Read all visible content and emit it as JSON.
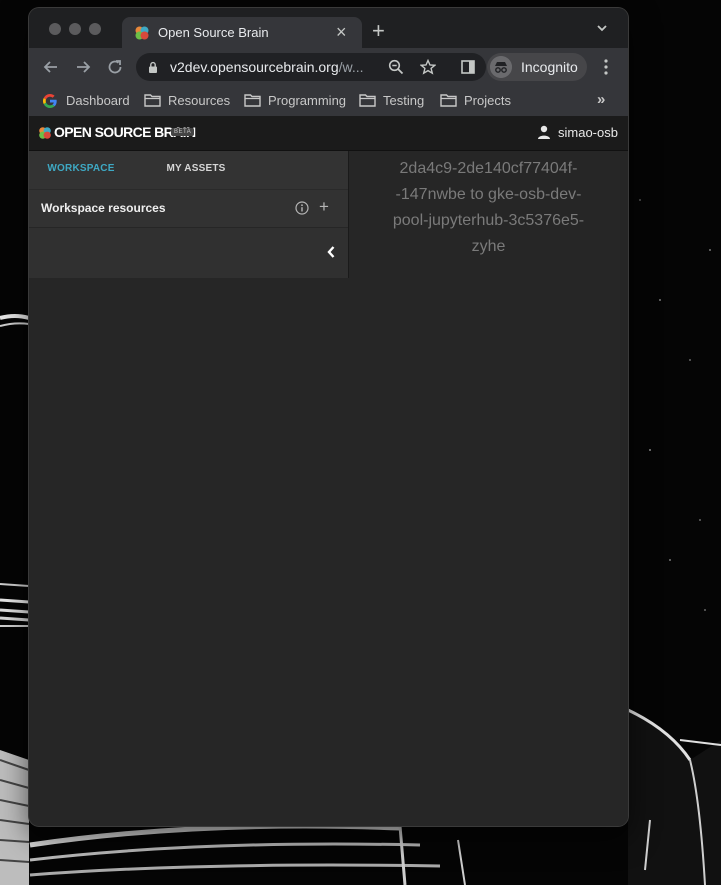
{
  "browser": {
    "tab": {
      "title": "Open Source Brain",
      "close_glyph": "×"
    },
    "new_tab_glyph": "+",
    "address": {
      "url_host": "v2dev.opensourcebrain.org",
      "url_path": "/w..."
    },
    "profile_label": "Incognito",
    "bookmarks": [
      {
        "label": "Dashboard",
        "icon": "google-icon"
      },
      {
        "label": "Resources",
        "icon": "folder-icon"
      },
      {
        "label": "Programming",
        "icon": "folder-icon"
      },
      {
        "label": "Testing",
        "icon": "folder-icon"
      },
      {
        "label": "Projects",
        "icon": "folder-icon"
      }
    ],
    "bookmarks_overflow_glyph": "»"
  },
  "app": {
    "brand": "OPEN SOURCE BRAIN",
    "badge": "BETA",
    "user": "simao-osb"
  },
  "workspace": {
    "tabs": [
      {
        "label": "WORKSPACE",
        "active": true
      },
      {
        "label": "MY ASSETS",
        "active": false
      }
    ],
    "resources_title": "Workspace resources",
    "add_glyph": "+",
    "log_text": "2da4c9-2de140cf77404f-\n-147nwbe to gke-osb-dev-\npool-jupyterhub-3c5376e5-\nzyhe"
  },
  "colors": {
    "accent": "#3ea9c4",
    "window_bg": "#262626",
    "toolbar_bg": "#35363a"
  }
}
